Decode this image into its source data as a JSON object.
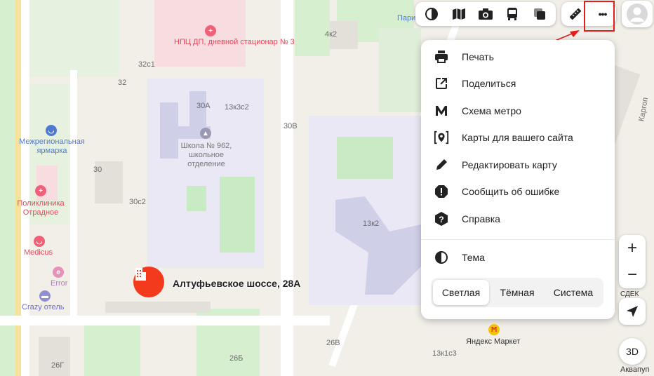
{
  "toolbar": {
    "layers_icon": "layers-icon",
    "items": [
      {
        "name": "layers-button",
        "icon": "layers-icon"
      },
      {
        "name": "panorama-button",
        "icon": "map-book-icon"
      },
      {
        "name": "photo-button",
        "icon": "camera-icon"
      },
      {
        "name": "transport-button",
        "icon": "bus-icon"
      },
      {
        "name": "overlay-button",
        "icon": "stack-icon"
      }
    ]
  },
  "toolbar2": {
    "ruler_icon": "ruler-icon",
    "more_icon": "more-dots-icon",
    "more_label": "•••"
  },
  "menu": {
    "items": [
      {
        "label": "Печать",
        "icon": "printer-icon"
      },
      {
        "label": "Поделиться",
        "icon": "share-icon"
      },
      {
        "label": "Схема метро",
        "icon": "metro-m-icon"
      },
      {
        "label": "Карты для вашего сайта",
        "icon": "map-pin-code-icon"
      },
      {
        "label": "Редактировать карту",
        "icon": "pencil-icon"
      },
      {
        "label": "Сообщить об ошибке",
        "icon": "alert-icon"
      },
      {
        "label": "Справка",
        "icon": "help-icon"
      },
      {
        "label": "Тема",
        "icon": "theme-icon"
      }
    ],
    "theme_options": [
      "Светлая",
      "Тёмная",
      "Система"
    ],
    "theme_selected": "Светлая"
  },
  "map": {
    "address": "Алтуфьевское шоссе, 28А",
    "labels": {
      "npc": "НПЦ ДП, дневной стационар № 3",
      "school": "Школа № 962, школьное отделение",
      "fair": "Межрегиональная ярмарка",
      "clinic": "Поликлиника Отрадное",
      "medicus": "Medicus",
      "error": "Error",
      "crazy": "Crazy отель",
      "market": "Яндекс Маркет",
      "cdek": "СДЕК",
      "akvapup": "Аквапуп",
      "pari": "Пари",
      "kargo": "Каргоп",
      "b32c1": "32с1",
      "b32": "32",
      "b30a": "30А",
      "b13k3c2": "13к3с2",
      "b4k2": "4к2",
      "b30v": "30В",
      "b30": "30",
      "b30c2": "30с2",
      "b13k2": "13к2",
      "b26g": "26Г",
      "b26b": "26Б",
      "b26v": "26В",
      "b13k1c3": "13к1с3"
    }
  },
  "controls": {
    "zoom_in": "+",
    "zoom_out": "−",
    "button_3d": "3D",
    "locate_icon": "navigation-arrow-icon"
  },
  "colors": {
    "highlight_red": "#e31c1c",
    "pin_red": "#f43a1d",
    "map_bg": "#f2efe9",
    "park_green": "#c8ebc3",
    "building_violet": "#d0cfe8"
  }
}
